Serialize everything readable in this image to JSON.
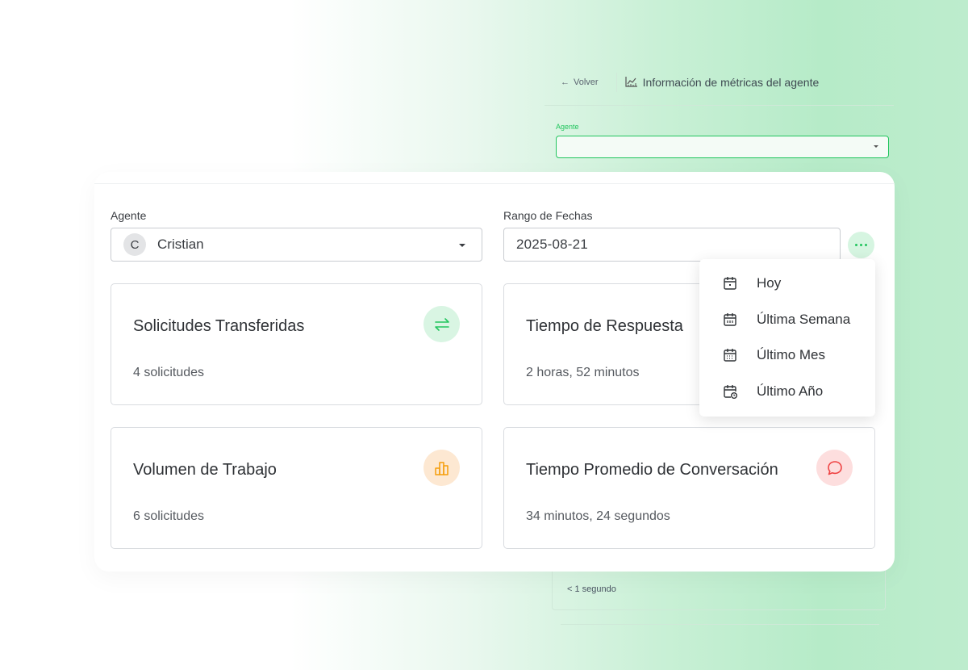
{
  "background_app": {
    "back_label": "Volver",
    "title": "Información de métricas del agente",
    "agent_label": "Agente",
    "card_value": "< 1 segundo"
  },
  "filters": {
    "agent_label": "Agente",
    "agent_initial": "C",
    "agent_value": "Cristian",
    "date_label": "Rango de Fechas",
    "date_value": "2025-08-21"
  },
  "cards": [
    {
      "title": "Solicitudes Transferidas",
      "value": "4 solicitudes",
      "icon": "transfer-arrows-icon",
      "color": "#22c55e",
      "bg": "#d9f5e3"
    },
    {
      "title": "Tiempo de Respuesta",
      "value": "2 horas, 52 minutos",
      "icon": "clock-icon",
      "color": "#3b82f6",
      "bg": "#dbeafe"
    },
    {
      "title": "Volumen de Trabajo",
      "value": "6 solicitudes",
      "icon": "bar-chart-icon",
      "color": "#f59e0b",
      "bg": "#fde8d2"
    },
    {
      "title": "Tiempo Promedio de Conversación",
      "value": "34 minutos, 24 segundos",
      "icon": "chat-bubble-icon",
      "color": "#ef4444",
      "bg": "#fddede"
    }
  ],
  "date_menu": {
    "items": [
      {
        "label": "Hoy",
        "icon": "calendar-day-icon"
      },
      {
        "label": "Última Semana",
        "icon": "calendar-week-icon"
      },
      {
        "label": "Último Mes",
        "icon": "calendar-month-icon"
      },
      {
        "label": "Último Año",
        "icon": "calendar-clock-icon"
      }
    ]
  }
}
